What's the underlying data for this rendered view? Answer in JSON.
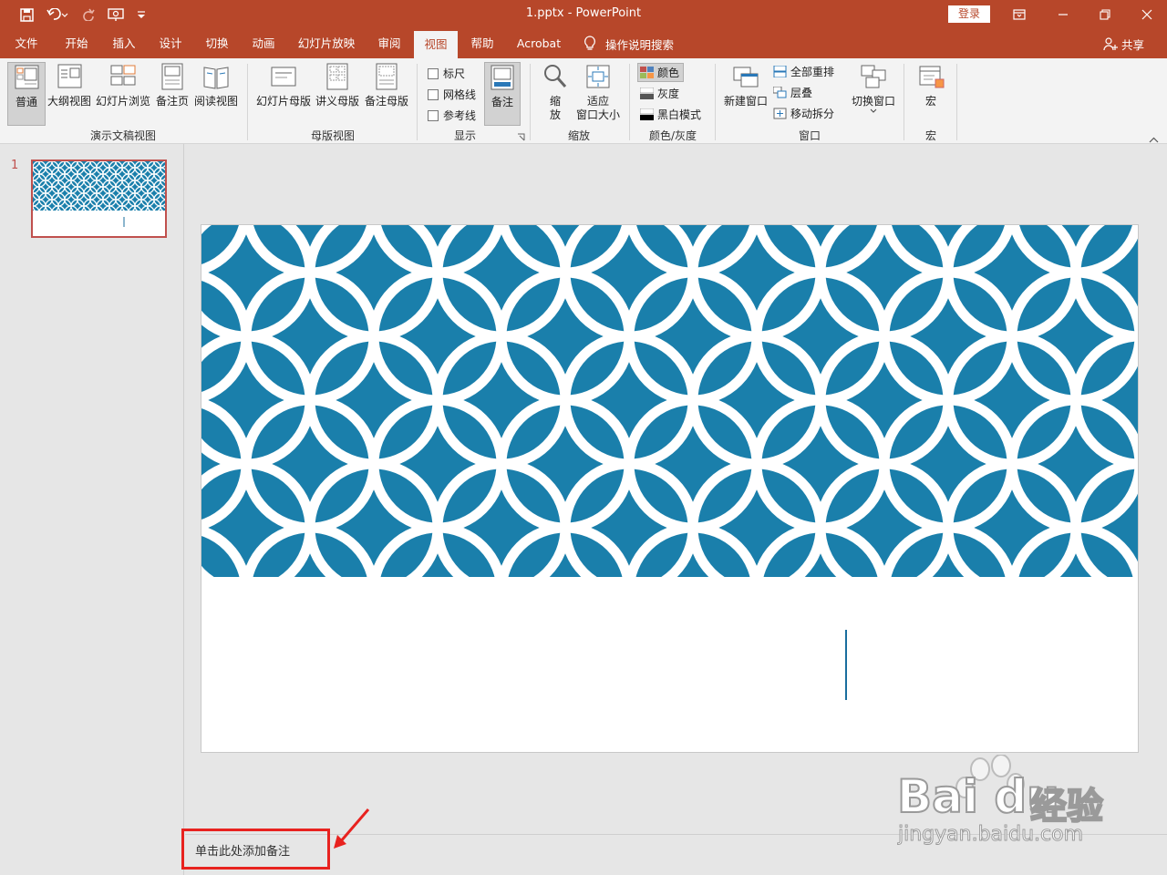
{
  "window": {
    "title": "1.pptx  -  PowerPoint",
    "login_label": "登录",
    "accent_color": "#b7472a"
  },
  "tabs": [
    {
      "label": "文件"
    },
    {
      "label": "开始"
    },
    {
      "label": "插入"
    },
    {
      "label": "设计"
    },
    {
      "label": "切换"
    },
    {
      "label": "动画"
    },
    {
      "label": "幻灯片放映"
    },
    {
      "label": "审阅"
    },
    {
      "label": "视图",
      "active": true
    },
    {
      "label": "帮助"
    },
    {
      "label": "Acrobat"
    }
  ],
  "tell_me": "操作说明搜索",
  "share_label": "共享",
  "ribbon": {
    "presentation_views": {
      "label": "演示文稿视图",
      "buttons": [
        "普通",
        "大纲视图",
        "幻灯片浏览",
        "备注页",
        "阅读视图"
      ]
    },
    "master_views": {
      "label": "母版视图",
      "buttons": [
        "幻灯片母版",
        "讲义母版",
        "备注母版"
      ]
    },
    "show": {
      "label": "显示",
      "checkboxes": [
        "标尺",
        "网格线",
        "参考线"
      ],
      "notes_button": "备注"
    },
    "zoom": {
      "label": "缩放",
      "zoom_button": [
        "缩",
        "放"
      ],
      "fit_button": [
        "适应",
        "窗口大小"
      ]
    },
    "color": {
      "label": "颜色/灰度",
      "options": [
        "颜色",
        "灰度",
        "黑白模式"
      ]
    },
    "window": {
      "label": "窗口",
      "new_window": "新建窗口",
      "arrange_all": "全部重排",
      "cascade": "层叠",
      "move_split": "移动拆分",
      "switch_windows": "切换窗口"
    },
    "macros": {
      "label": "宏",
      "button": "宏"
    }
  },
  "thumbnails": [
    {
      "number": "1"
    }
  ],
  "notes_placeholder": "单击此处添加备注",
  "watermark": {
    "brand": "Bai du",
    "brand2": "经验",
    "url": "jingyan.baidu.com"
  },
  "slide_pattern_color": "#1a7fab"
}
